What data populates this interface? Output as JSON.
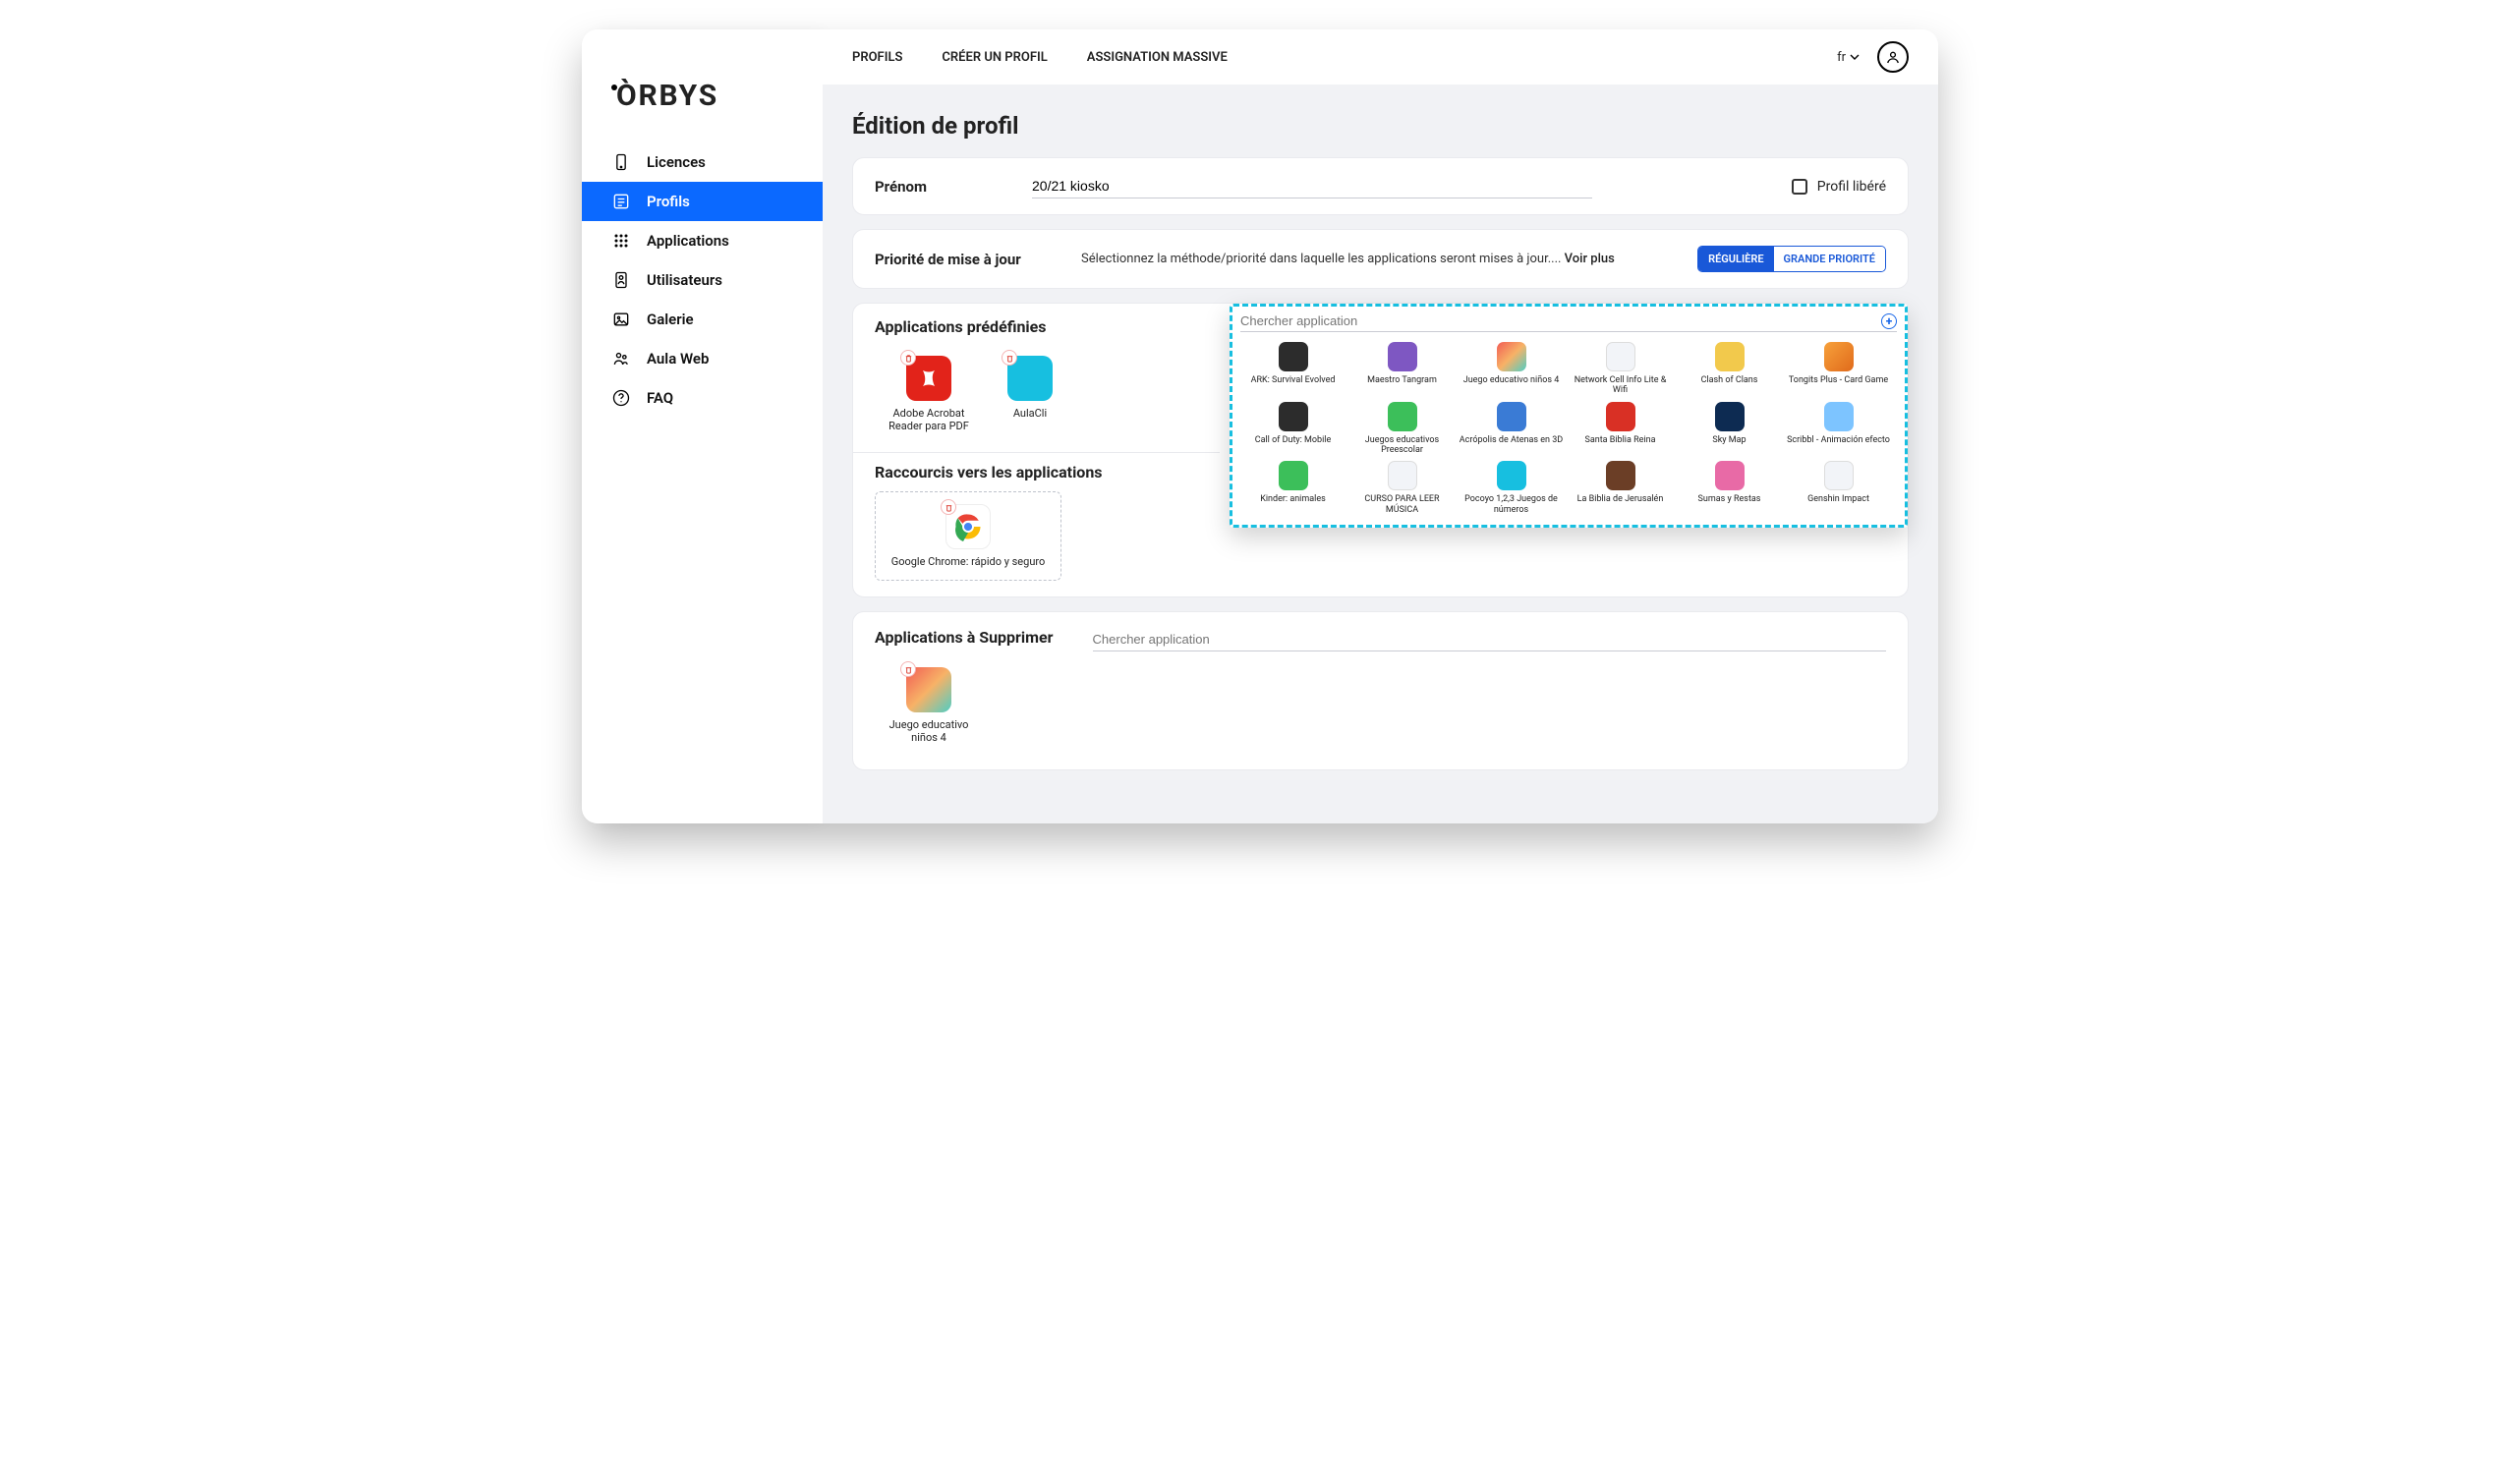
{
  "brand": "ÒRBYS",
  "lang": {
    "code": "fr"
  },
  "topnav": {
    "profiles": "PROFILS",
    "create": "CRÉER UN PROFIL",
    "bulk": "ASSIGNATION MASSIVE"
  },
  "sidebar": {
    "items": [
      {
        "label": "Licences"
      },
      {
        "label": "Profils"
      },
      {
        "label": "Applications"
      },
      {
        "label": "Utilisateurs"
      },
      {
        "label": "Galerie"
      },
      {
        "label": "Aula Web"
      },
      {
        "label": "FAQ"
      }
    ]
  },
  "page": {
    "title": "Édition de profil"
  },
  "name_field": {
    "label": "Prénom",
    "value": "20/21 kiosko"
  },
  "released": {
    "label": "Profil libéré"
  },
  "priority": {
    "label": "Priorité de mise à jour",
    "desc": "Sélectionnez la méthode/priorité dans laquelle les applications seront mises à jour....",
    "more": "Voir plus",
    "regular": "RÉGULIÈRE",
    "high": "GRANDE PRIORITÉ"
  },
  "predef": {
    "title": "Applications prédéfinies",
    "apps": [
      {
        "label": "Adobe Acrobat Reader para PDF"
      },
      {
        "label": "AulaCli"
      }
    ]
  },
  "dropdown": {
    "search_placeholder": "Chercher application",
    "items": [
      {
        "label": "ARK: Survival Evolved",
        "c": "ic-dark"
      },
      {
        "label": "Maestro Tangram",
        "c": "ic-purple"
      },
      {
        "label": "Juego educativo niños 4",
        "c": "ic-multi"
      },
      {
        "label": "Network Cell Info Lite & Wifi",
        "c": "ic-white"
      },
      {
        "label": "Clash of Clans",
        "c": "ic-yellow"
      },
      {
        "label": "Tongits Plus - Card Game",
        "c": "ic-orange"
      },
      {
        "label": "Call of Duty: Mobile",
        "c": "ic-dark"
      },
      {
        "label": "Juegos educativos Preescolar",
        "c": "ic-green"
      },
      {
        "label": "Acrópolis de Atenas en 3D",
        "c": "ic-blue"
      },
      {
        "label": "Santa Biblia Reina",
        "c": "ic-red"
      },
      {
        "label": "Sky Map",
        "c": "ic-navy"
      },
      {
        "label": "Scribbl - Animación efecto",
        "c": "ic-sky"
      },
      {
        "label": "Kinder: animales",
        "c": "ic-green"
      },
      {
        "label": "CURSO PARA LEER MÚSICA",
        "c": "ic-white"
      },
      {
        "label": "Pocoyo 1,2,3 Juegos de números",
        "c": "ic-teal"
      },
      {
        "label": "La Biblia de Jerusalén",
        "c": "ic-brown"
      },
      {
        "label": "Sumas y Restas",
        "c": "ic-pink"
      },
      {
        "label": "Genshin Impact",
        "c": "ic-white"
      }
    ]
  },
  "shortcuts": {
    "title": "Raccourcis vers les applications",
    "apps": [
      {
        "label": "Google Chrome: rápido y seguro"
      }
    ]
  },
  "to_delete": {
    "title": "Applications à Supprimer",
    "search_placeholder": "Chercher application",
    "apps": [
      {
        "label": "Juego educativo niños 4"
      }
    ]
  }
}
